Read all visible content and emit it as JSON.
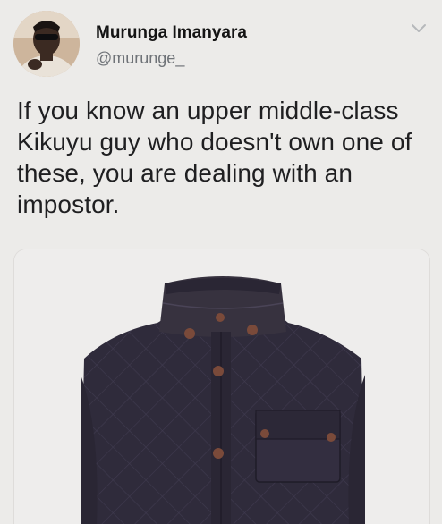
{
  "tweet": {
    "author": {
      "display_name": "Murunga Imanyara",
      "handle": "@murunge_",
      "avatar_icon": "profile-photo"
    },
    "menu_icon": "chevron-down-icon",
    "text": "If you know an upper middle-class Kikuyu guy who doesn't own one of these, you are dealing with an impostor.",
    "media": {
      "description_icon": "quilted-vest-photo"
    }
  },
  "colors": {
    "background": "#ecebe9",
    "handle": "#6f7378",
    "vest": "#2e2a3a"
  }
}
